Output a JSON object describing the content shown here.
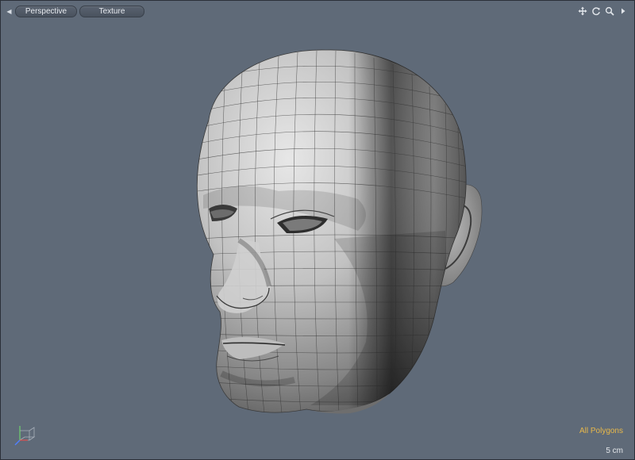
{
  "viewport": {
    "view_mode": "Perspective",
    "shading_mode": "Texture",
    "selection_mode": "All Polygons",
    "grid_scale": "5 cm"
  },
  "icons": {
    "menu_arrow": "left-triangle-icon",
    "pan": "move-icon",
    "rotate": "rotate-icon",
    "zoom": "zoom-icon",
    "more": "right-triangle-icon",
    "gizmo": "axis-gizmo-icon"
  },
  "colors": {
    "viewport_bg": "#5f6a78",
    "status_text": "#e8b84a"
  }
}
